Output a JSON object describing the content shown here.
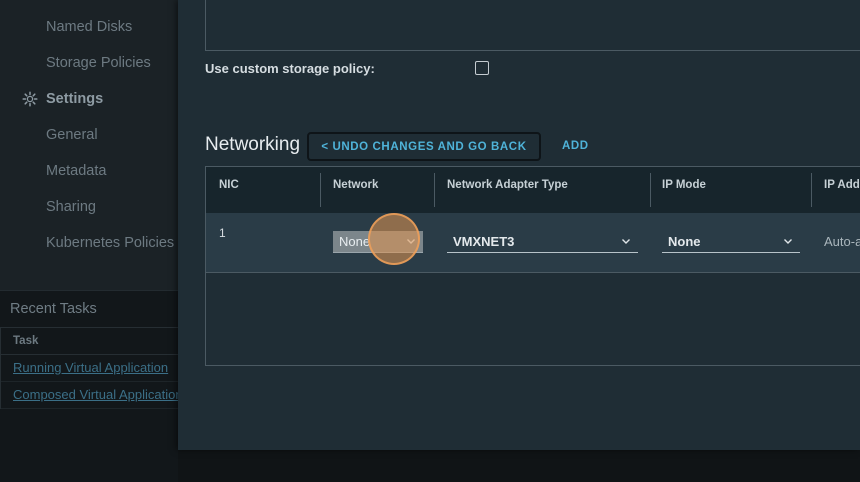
{
  "left_nav": {
    "items": [
      {
        "label": "Named Disks"
      },
      {
        "label": "Storage Policies"
      }
    ],
    "section": {
      "label": "Settings",
      "icon": "gear-icon"
    },
    "settings_items": [
      {
        "label": "General"
      },
      {
        "label": "Metadata"
      },
      {
        "label": "Sharing"
      },
      {
        "label": "Kubernetes Policies"
      }
    ]
  },
  "recent_tasks": {
    "title": "Recent Tasks",
    "column": "Task",
    "rows": [
      {
        "label": "Running Virtual Application"
      },
      {
        "label": "Composed Virtual Application"
      }
    ]
  },
  "modal": {
    "storage_policy_label": "Use custom storage policy:",
    "storage_policy_checked": false,
    "networking": {
      "title": "Networking",
      "undo_label": "< UNDO CHANGES AND GO BACK",
      "add_label": "ADD",
      "columns": [
        "NIC",
        "Network",
        "Network Adapter Type",
        "IP Mode",
        "IP Address"
      ],
      "rows": [
        {
          "nic": "1",
          "network": "None",
          "adapter_type": "VMXNET3",
          "ip_mode": "None",
          "ip_address": "Auto-assigned"
        }
      ]
    }
  },
  "colors": {
    "accent": "#4fb3d9",
    "modal_bg": "#1f2d35",
    "cursor": "#e29650"
  }
}
